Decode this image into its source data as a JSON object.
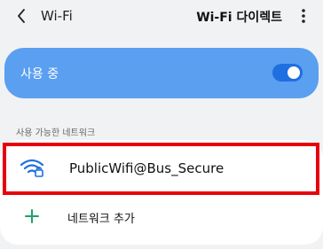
{
  "header": {
    "title": "Wi-Fi",
    "direct_label": "Wi-Fi 다이렉트",
    "back_icon": "back-chevron-icon",
    "more_icon": "more-vertical-icon"
  },
  "master_switch": {
    "label": "사용 중",
    "state": "on",
    "card_color": "#5a9ff0",
    "toggle_color": "#1f6fe0"
  },
  "available_section": {
    "header": "사용 가능한 네트워크",
    "networks": [
      {
        "name": "PublicWifi@Bus_Secure",
        "icon": "wifi-secured-icon",
        "highlighted": true
      }
    ],
    "add_network_label": "네트워크 추가",
    "add_icon": "plus-icon",
    "accent_color": "#1aa36a",
    "highlight_color": "#e8000b"
  }
}
